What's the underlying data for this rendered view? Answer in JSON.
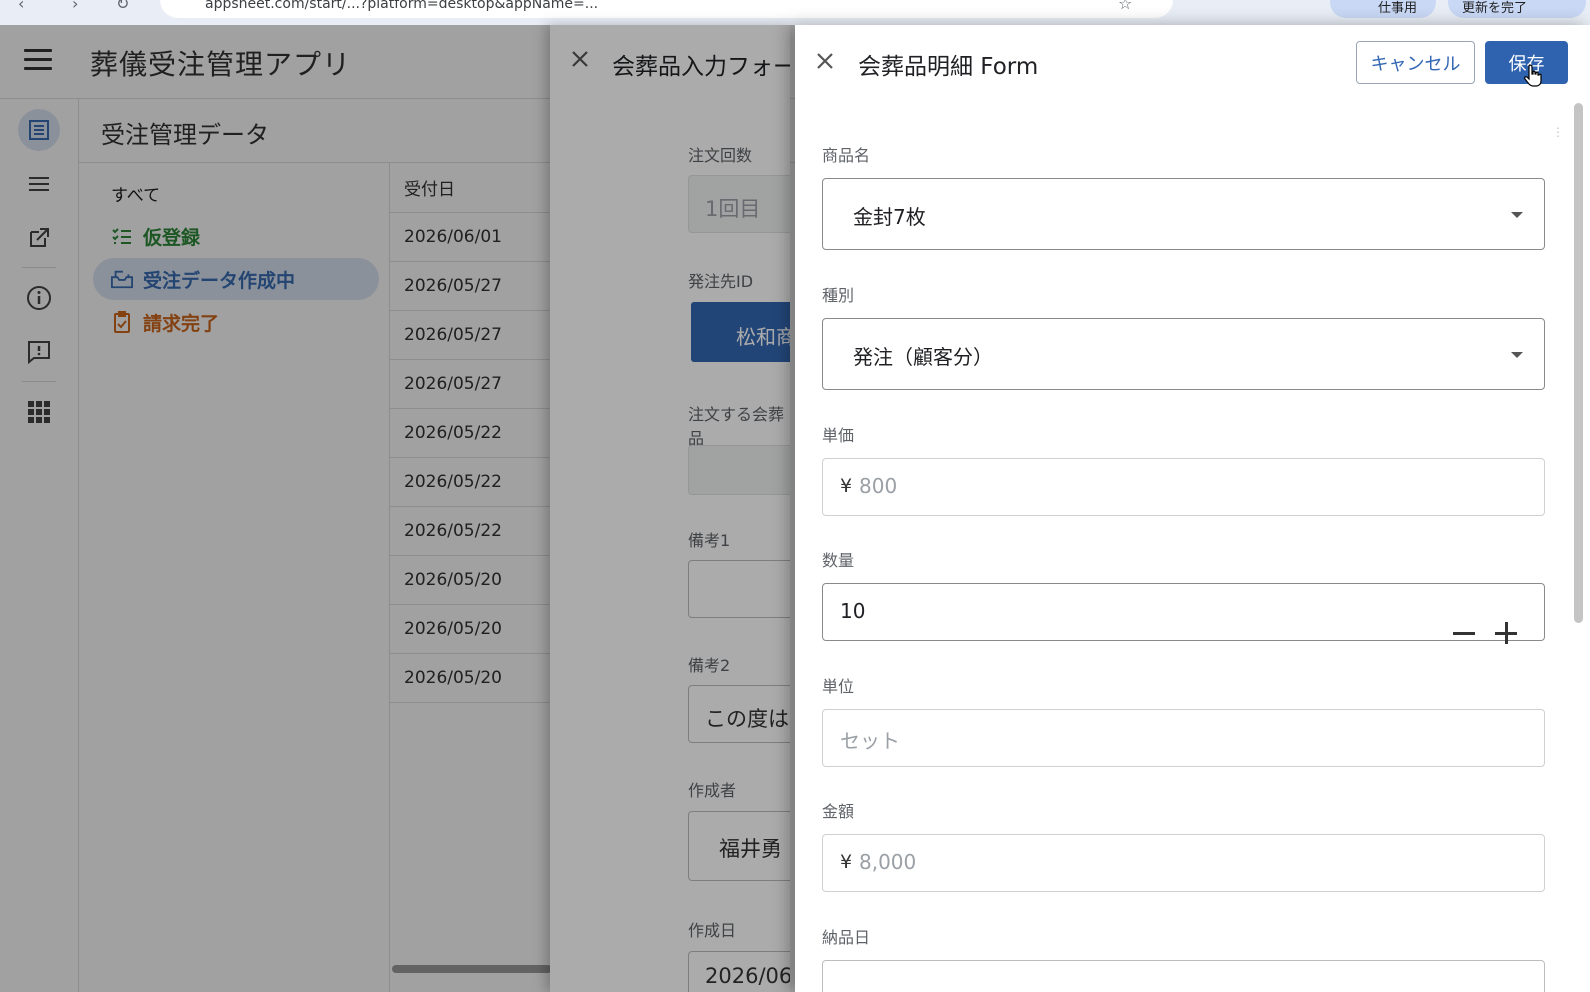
{
  "browser": {
    "url": "appsheet.com/start/...?platform=desktop&appName=...",
    "profile_label": "仕事用",
    "update_label": "更新を完了"
  },
  "app": {
    "title": "葬儀受注管理アプリ",
    "section_title": "受注管理データ",
    "filters": [
      {
        "label": "すべて",
        "color": "#202124",
        "icon": ""
      },
      {
        "label": "仮登録",
        "color": "#2e8b3a",
        "icon": "checklist-icon"
      },
      {
        "label": "受注データ作成中",
        "color": "#3b6fb6",
        "icon": "inbox-icon"
      },
      {
        "label": "請求完了",
        "color": "#d2691e",
        "icon": "clipboard-check-icon"
      }
    ],
    "table": {
      "header": "受付日",
      "rows": [
        "2026/06/01",
        "2026/05/27",
        "2026/05/27",
        "2026/05/27",
        "2026/05/22",
        "2026/05/22",
        "2026/05/22",
        "2026/05/20",
        "2026/05/20",
        "2026/05/20"
      ]
    }
  },
  "order_form": {
    "title": "会葬品入力フォーム",
    "order_count_label": "注文回数",
    "order_count_value": "1回目",
    "supplier_id_label": "発注先ID",
    "supplier_button": "松和商",
    "items_label": "注文する会葬品",
    "note1_label": "備考1",
    "note2_label": "備考2",
    "note2_value": "この度は",
    "creator_label": "作成者",
    "creator_value": "福井勇",
    "created_date_label": "作成日",
    "created_date_value": "2026/06"
  },
  "detail_form": {
    "title": "会葬品明細 Form",
    "cancel_label": "キャンセル",
    "save_label": "保存",
    "product_label": "商品名",
    "product_value": "金封7枚",
    "type_label": "種別",
    "type_value": "発注（顧客分）",
    "unit_price_label": "単価",
    "currency_prefix": "¥",
    "unit_price_placeholder": "800",
    "quantity_label": "数量",
    "quantity_value": "10",
    "unit_label": "単位",
    "unit_placeholder": "セット",
    "amount_label": "金額",
    "amount_placeholder": "8,000",
    "delivery_label": "納品日"
  },
  "colors": {
    "primary": "#2f63b0",
    "active_filter_bg": "#dbe6f7",
    "green": "#2e8b3a",
    "orange": "#d2691e"
  }
}
